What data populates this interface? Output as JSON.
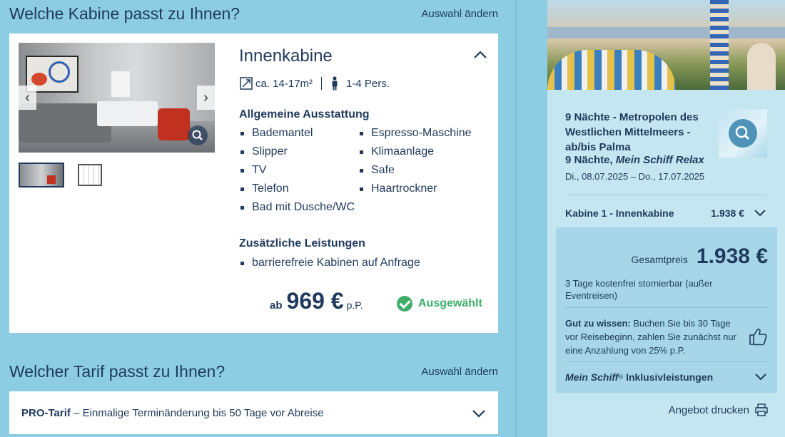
{
  "cabin_section": {
    "title": "Welche Kabine passt zu Ihnen?",
    "change_label": "Auswahl ändern",
    "cabin": {
      "name": "Innenkabine",
      "size": "ca. 14-17m²",
      "persons": "1-4 Pers.",
      "features_heading": "Allgemeine Ausstattung",
      "features": [
        "Bademantel",
        "Espresso-Maschine",
        "Slipper",
        "Klimaanlage",
        "TV",
        "Safe",
        "Telefon",
        "Haartrockner",
        "Bad mit Dusche/WC"
      ],
      "extras_heading": "Zusätzliche Leistungen",
      "extras": [
        "barrierefreie Kabinen auf Anfrage"
      ],
      "price_prefix": "ab",
      "price": "969 €",
      "price_suffix": "p.P.",
      "selected_label": "Ausgewählt"
    }
  },
  "tarif_section": {
    "title": "Welcher Tarif passt zu Ihnen?",
    "change_label": "Auswahl ändern",
    "tarif_name": "PRO-Tarif",
    "tarif_desc": " – Einmalige Terminänderung bis 50 Tage vor Abreise"
  },
  "summary": {
    "trip_title": "9 Nächte - Metropolen des Westlichen Mittelmeers - ab/bis Palma",
    "trip_nights": "9 Nächte, ",
    "trip_ship": "Mein Schiff Relax",
    "trip_dates": "Di., 08.07.2025 – Do., 17.07.2025",
    "cabin_label": "Kabine 1 - Innenkabine",
    "cabin_price": "1.938 €",
    "total_label": "Gesamtpreis",
    "total_price": "1.938 €",
    "storno": "3 Tage kostenfrei stornierbar (außer Eventreisen)",
    "info_bold": "Gut zu wissen:",
    "info_text": " Buchen Sie bis 30 Tage vor Reisebeginn, zahlen Sie zunächst nur eine Anzahlung von 25% p.P.",
    "incl_brand": "Mein Schiff",
    "incl_reg": "®",
    "incl_rest": "Inklusivleistungen",
    "print_label": "Angebot drucken"
  },
  "icons": {
    "size": "resize-icon",
    "persons": "person-icon",
    "zoom": "magnifier-icon",
    "chevron": "chevron-icon",
    "check": "check-circle-icon",
    "thumbs": "thumbs-up-icon",
    "print": "printer-icon"
  },
  "colors": {
    "background": "#8ccde3",
    "summary_bg": "#c3e6f1",
    "total_bg": "#a6d6e7",
    "text": "#1f3a5c",
    "selected": "#3fae6a"
  }
}
